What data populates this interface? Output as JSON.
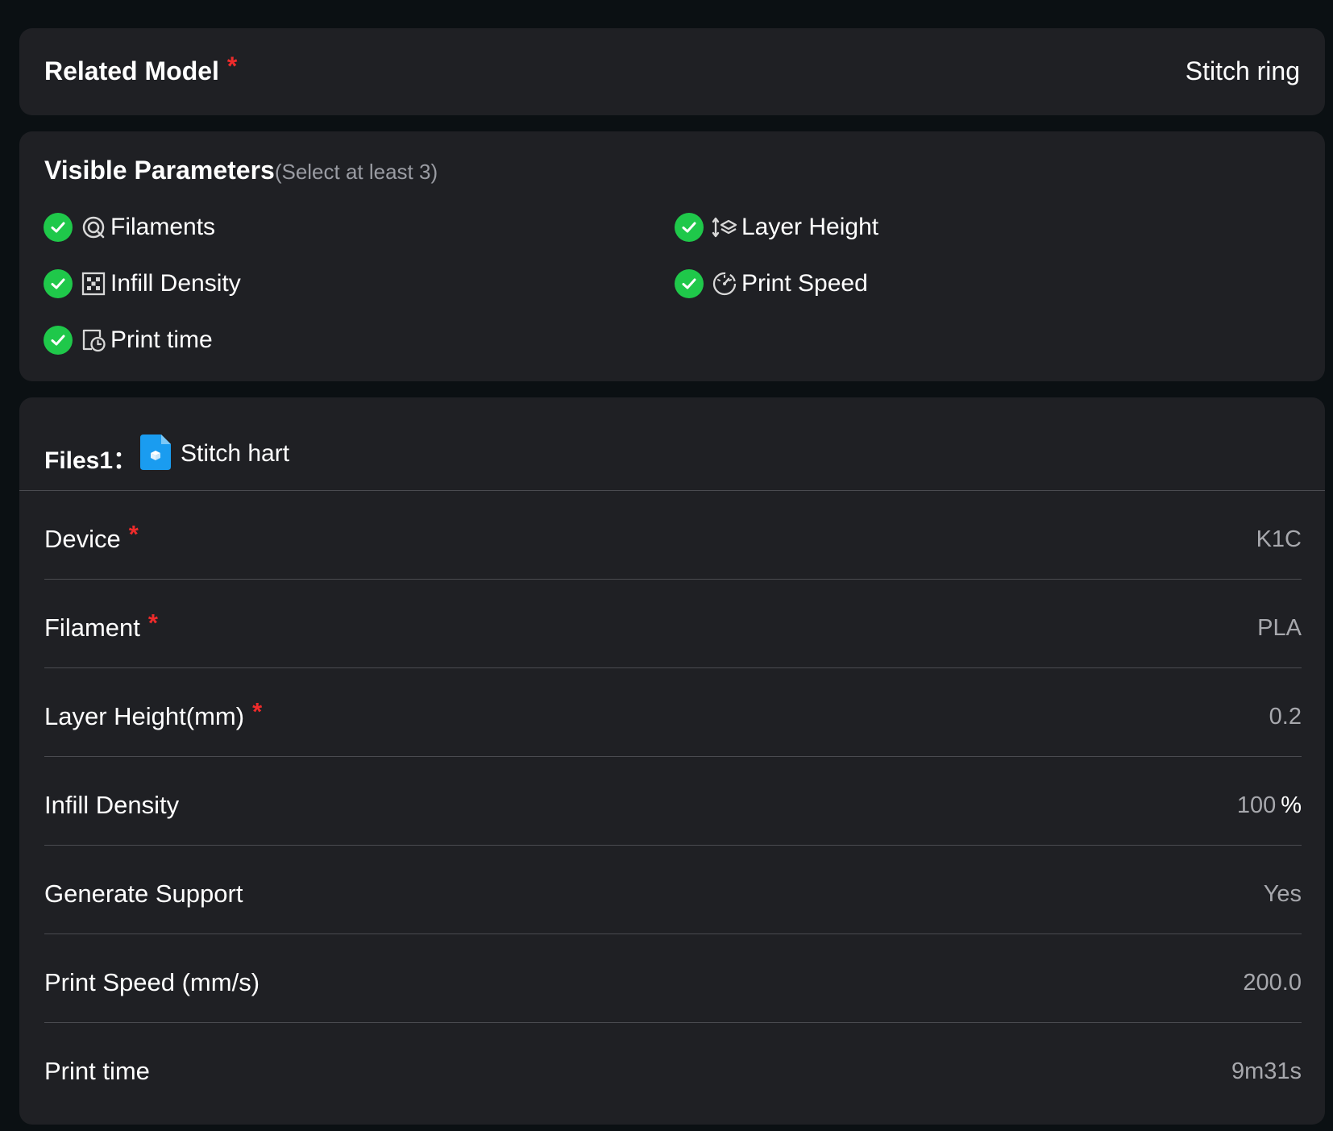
{
  "related_model": {
    "label": "Related Model",
    "required_mark": "*",
    "value": "Stitch ring"
  },
  "visible_parameters": {
    "title": "Visible Parameters",
    "hint": "(Select at least 3)",
    "items": [
      {
        "label": "Filaments",
        "icon": "filament-spool-icon",
        "checked": true
      },
      {
        "label": "Layer Height",
        "icon": "layer-height-icon",
        "checked": true
      },
      {
        "label": "Infill Density",
        "icon": "infill-grid-icon",
        "checked": true
      },
      {
        "label": "Print Speed",
        "icon": "speedometer-icon",
        "checked": true
      },
      {
        "label": "Print time",
        "icon": "print-time-icon",
        "checked": true
      }
    ]
  },
  "files": {
    "label": "Files1：",
    "file_name": "Stitch hart",
    "rows": [
      {
        "label": "Device",
        "required": true,
        "value": "K1C",
        "unit": ""
      },
      {
        "label": "Filament",
        "required": true,
        "value": "PLA",
        "unit": ""
      },
      {
        "label": "Layer Height(mm)",
        "required": true,
        "value": "0.2",
        "unit": ""
      },
      {
        "label": "Infill Density",
        "required": false,
        "value": "100",
        "unit": "%"
      },
      {
        "label": "Generate Support",
        "required": false,
        "value": "Yes",
        "unit": ""
      },
      {
        "label": "Print Speed (mm/s)",
        "required": false,
        "value": "200.0",
        "unit": ""
      },
      {
        "label": "Print time",
        "required": false,
        "value": "9m31s",
        "unit": ""
      }
    ]
  },
  "colors": {
    "background": "#0b1013",
    "card": "#1f2024",
    "check_green": "#1fc84a",
    "required_red": "#ee2b2b",
    "file_icon_blue": "#1a9cf0",
    "value_gray": "#a7a8ad"
  }
}
